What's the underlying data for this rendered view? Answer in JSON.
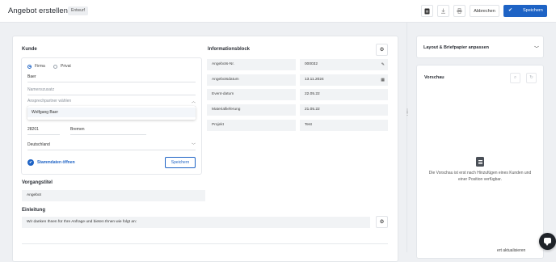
{
  "header": {
    "title": "Angebot erstellen",
    "badge": "Entwurf",
    "icons": [
      "document-icon",
      "download-icon",
      "print-icon"
    ],
    "cancel_label": "Abbrechen",
    "save_label": "Speichern"
  },
  "kunde": {
    "title": "Kunde",
    "radio_firma": "Firma",
    "radio_privat": "Privat",
    "selected": "Firma",
    "name_value": "Baer",
    "namenszusatz_placeholder": "Namenszusatz",
    "ansprechpartner_placeholder": "Ansprechpartner wählen",
    "dropdown_option": "Wolfgang Baer",
    "plz": "28201",
    "ort": "Bremen",
    "land": "Deutschland",
    "stammdaten_link": "Stammdaten öffnen",
    "save_button": "Speichern"
  },
  "informationsblock": {
    "title": "Informationsblock",
    "rows": [
      {
        "label": "Angebots-Nr.",
        "value": "000032",
        "icon": "pencil-icon"
      },
      {
        "label": "Angebotsdatum",
        "value": "13.11.2024",
        "icon": "calendar-icon"
      },
      {
        "label": "Event-datum",
        "value": "22.05.22",
        "icon": ""
      },
      {
        "label": "Materiallieferung",
        "value": "21.05.22",
        "icon": ""
      },
      {
        "label": "Projekt",
        "value": "Test",
        "icon": ""
      }
    ]
  },
  "vorgangstitel": {
    "title": "Vorgangstitel",
    "value": "Angebot"
  },
  "einleitung": {
    "title": "Einleitung",
    "value": "Wir danken Ihnen für Ihre Anfrage und bieten Ihnen wie folgt an:"
  },
  "sidebar": {
    "layout_title": "Layout & Briefpapier anpassen",
    "preview_title": "Vorschau",
    "preview_empty_text": "Die Vorschau ist erst nach Hinzufügen eines Kunden und einer Position verfügbar.",
    "auto_update_label": "ert aktualisieren"
  },
  "colors": {
    "accent": "#1e63c5",
    "field_bg": "#f1f3f5",
    "page_bg": "#eef0f3"
  }
}
